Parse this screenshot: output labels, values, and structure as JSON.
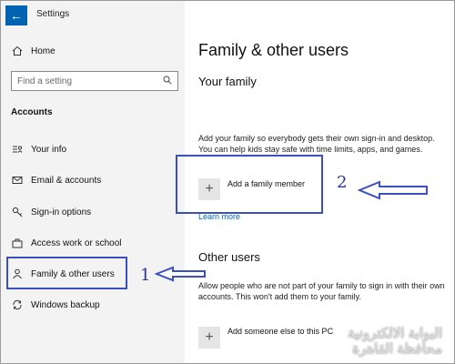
{
  "window": {
    "title": "Settings"
  },
  "sidebar": {
    "home_label": "Home",
    "search_placeholder": "Find a setting",
    "section_title": "Accounts",
    "items": [
      {
        "label": "Your info",
        "icon": "contact-card-icon"
      },
      {
        "label": "Email & accounts",
        "icon": "mail-icon"
      },
      {
        "label": "Sign-in options",
        "icon": "key-icon"
      },
      {
        "label": "Access work or school",
        "icon": "briefcase-icon"
      },
      {
        "label": "Family & other users",
        "icon": "person-icon",
        "active": true
      },
      {
        "label": "Windows backup",
        "icon": "sync-icon"
      }
    ]
  },
  "main": {
    "title": "Family & other users",
    "family": {
      "heading": "Your family",
      "description": "Add your family so everybody gets their own sign-in and desktop. You can help kids stay safe with time limits, apps, and games.",
      "add_label": "Add a family member",
      "learn_more": "Learn more"
    },
    "other_users": {
      "heading": "Other users",
      "description": "Allow people who are not part of your family to sign in with their own accounts. This won't add them to your family.",
      "add_label": "Add someone else to this PC"
    }
  },
  "annotations": {
    "step1": "1",
    "step2": "2",
    "color": "#3b4fbf"
  },
  "watermark": {
    "line1": "البوابة الالكترونية",
    "line2": "محافظة القاهرة"
  }
}
